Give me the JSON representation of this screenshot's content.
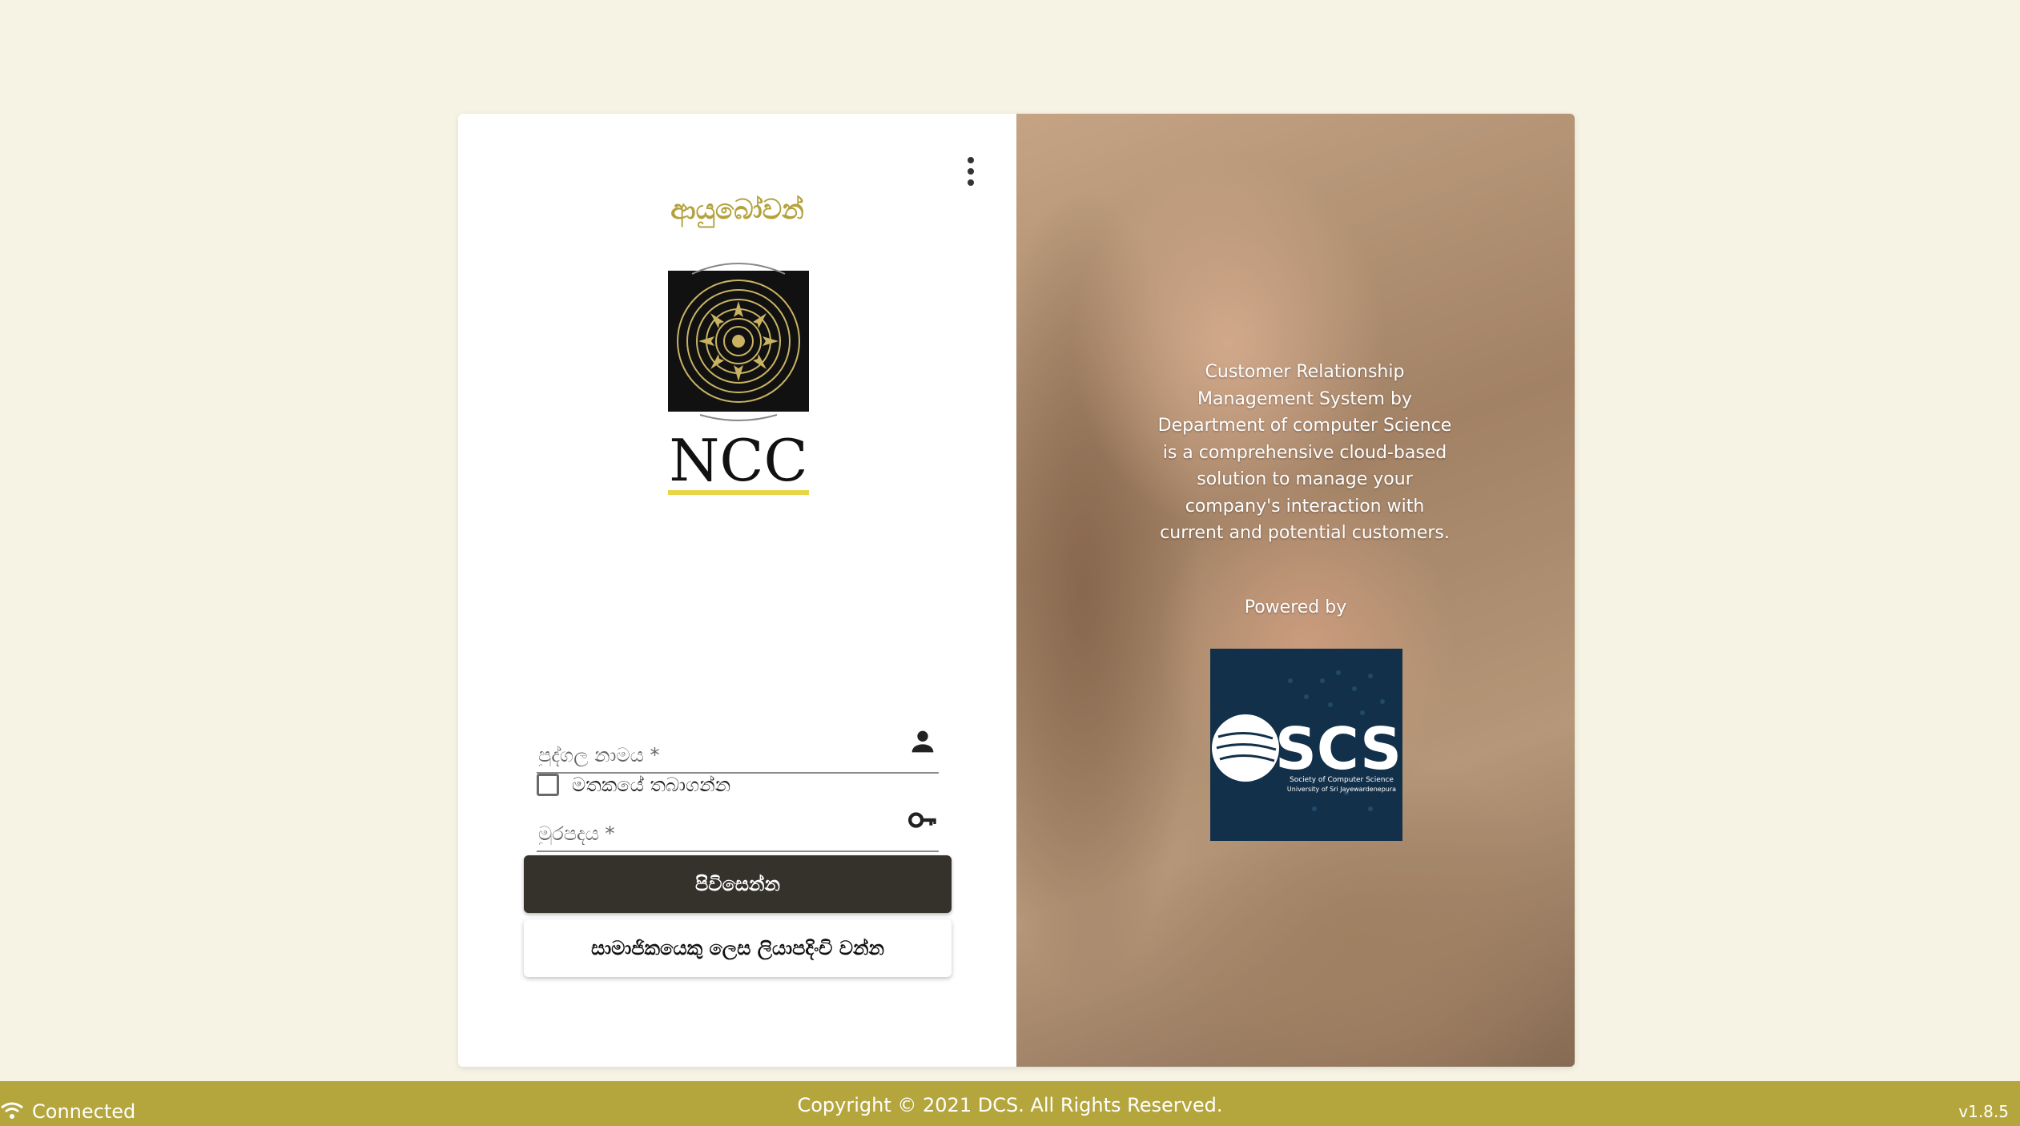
{
  "login": {
    "welcome": "ආයුබෝවන්",
    "logo_text": "NCC",
    "username_placeholder": "පුද්ගල නාමය *",
    "password_placeholder": "මුරපදය *",
    "remember_label": "මතකයේ තබාගන්න",
    "signin_label": "පිවිසෙන්න",
    "register_label": "සාමාජිකයෙකු ලෙස ලියාපදිංචි වන්න"
  },
  "info": {
    "description": "Customer Relationship Management System by Department of computer Science is a comprehensive cloud-based solution to manage your company's interaction with current and potential customers.",
    "powered_by": "Powered by",
    "scs_logo_text": "SCS",
    "scs_logo_subtitle_1": "Society of Computer Science",
    "scs_logo_subtitle_2": "University of Sri Jayewardenepura"
  },
  "footer": {
    "status": "Connected",
    "copyright": "Copyright © 2021 DCS. All Rights Reserved.",
    "version": "v1.8.5"
  },
  "colors": {
    "accent": "#b4a63c",
    "button_dark": "#34322a",
    "page_bg": "#f6f3e4"
  },
  "icons": {
    "menu": "more-vert-icon",
    "user": "person-icon",
    "password": "key-icon",
    "status": "wifi-icon"
  }
}
